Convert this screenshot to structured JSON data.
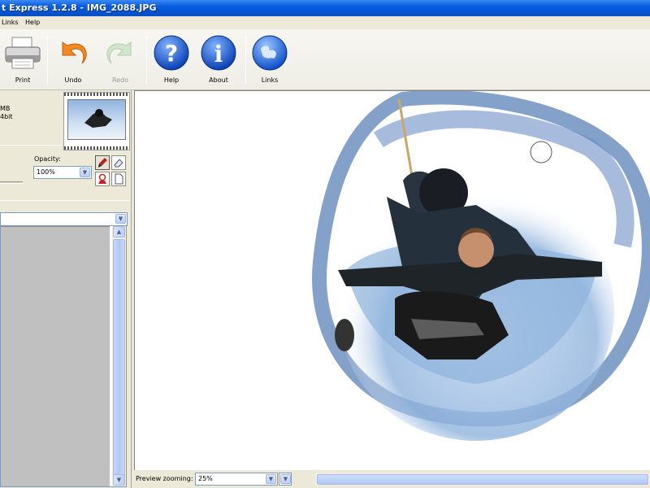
{
  "window": {
    "title": "t Express 1.2.8 - IMG_2088.JPG"
  },
  "menu": {
    "items": [
      "Links",
      "Help"
    ]
  },
  "toolbar": {
    "print_label": "Print",
    "undo_label": "Undo",
    "redo_label": "Redo",
    "help_label": "Help",
    "about_label": "About",
    "links_label": "Links"
  },
  "info": {
    "line1": "MB",
    "line2": "4bit"
  },
  "opacity": {
    "label": "Opacity:",
    "value": "100%"
  },
  "preview": {
    "zoom_label": "Preview zooming:",
    "zoom_value": "25%"
  },
  "colors": {
    "title_blue": "#0354d4",
    "sky": "#8fb3dd",
    "ring": "#5b82b8"
  },
  "icons": [
    "printer-icon",
    "undo-icon",
    "redo-icon",
    "help-icon",
    "about-icon",
    "links-globe-icon",
    "brush-icon",
    "eraser-icon",
    "stamp-icon",
    "page-icon"
  ]
}
